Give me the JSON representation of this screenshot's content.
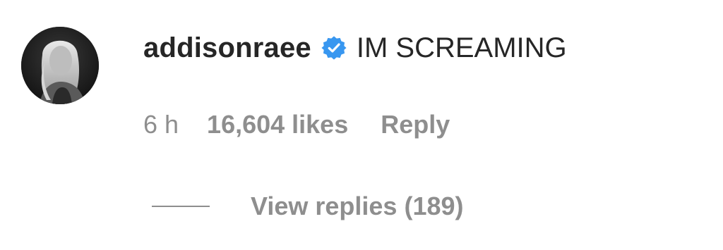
{
  "comment": {
    "username": "addisonraee",
    "verified_icon": "verified-badge-icon",
    "text": "IM SCREAMING",
    "time": "6 h",
    "likes": "16,604 likes",
    "reply_label": "Reply",
    "view_replies_label": "View replies (189)"
  },
  "colors": {
    "primary_text": "#262626",
    "secondary_text": "#8e8e8e",
    "verified_blue": "#3897f0",
    "background": "#ffffff"
  }
}
